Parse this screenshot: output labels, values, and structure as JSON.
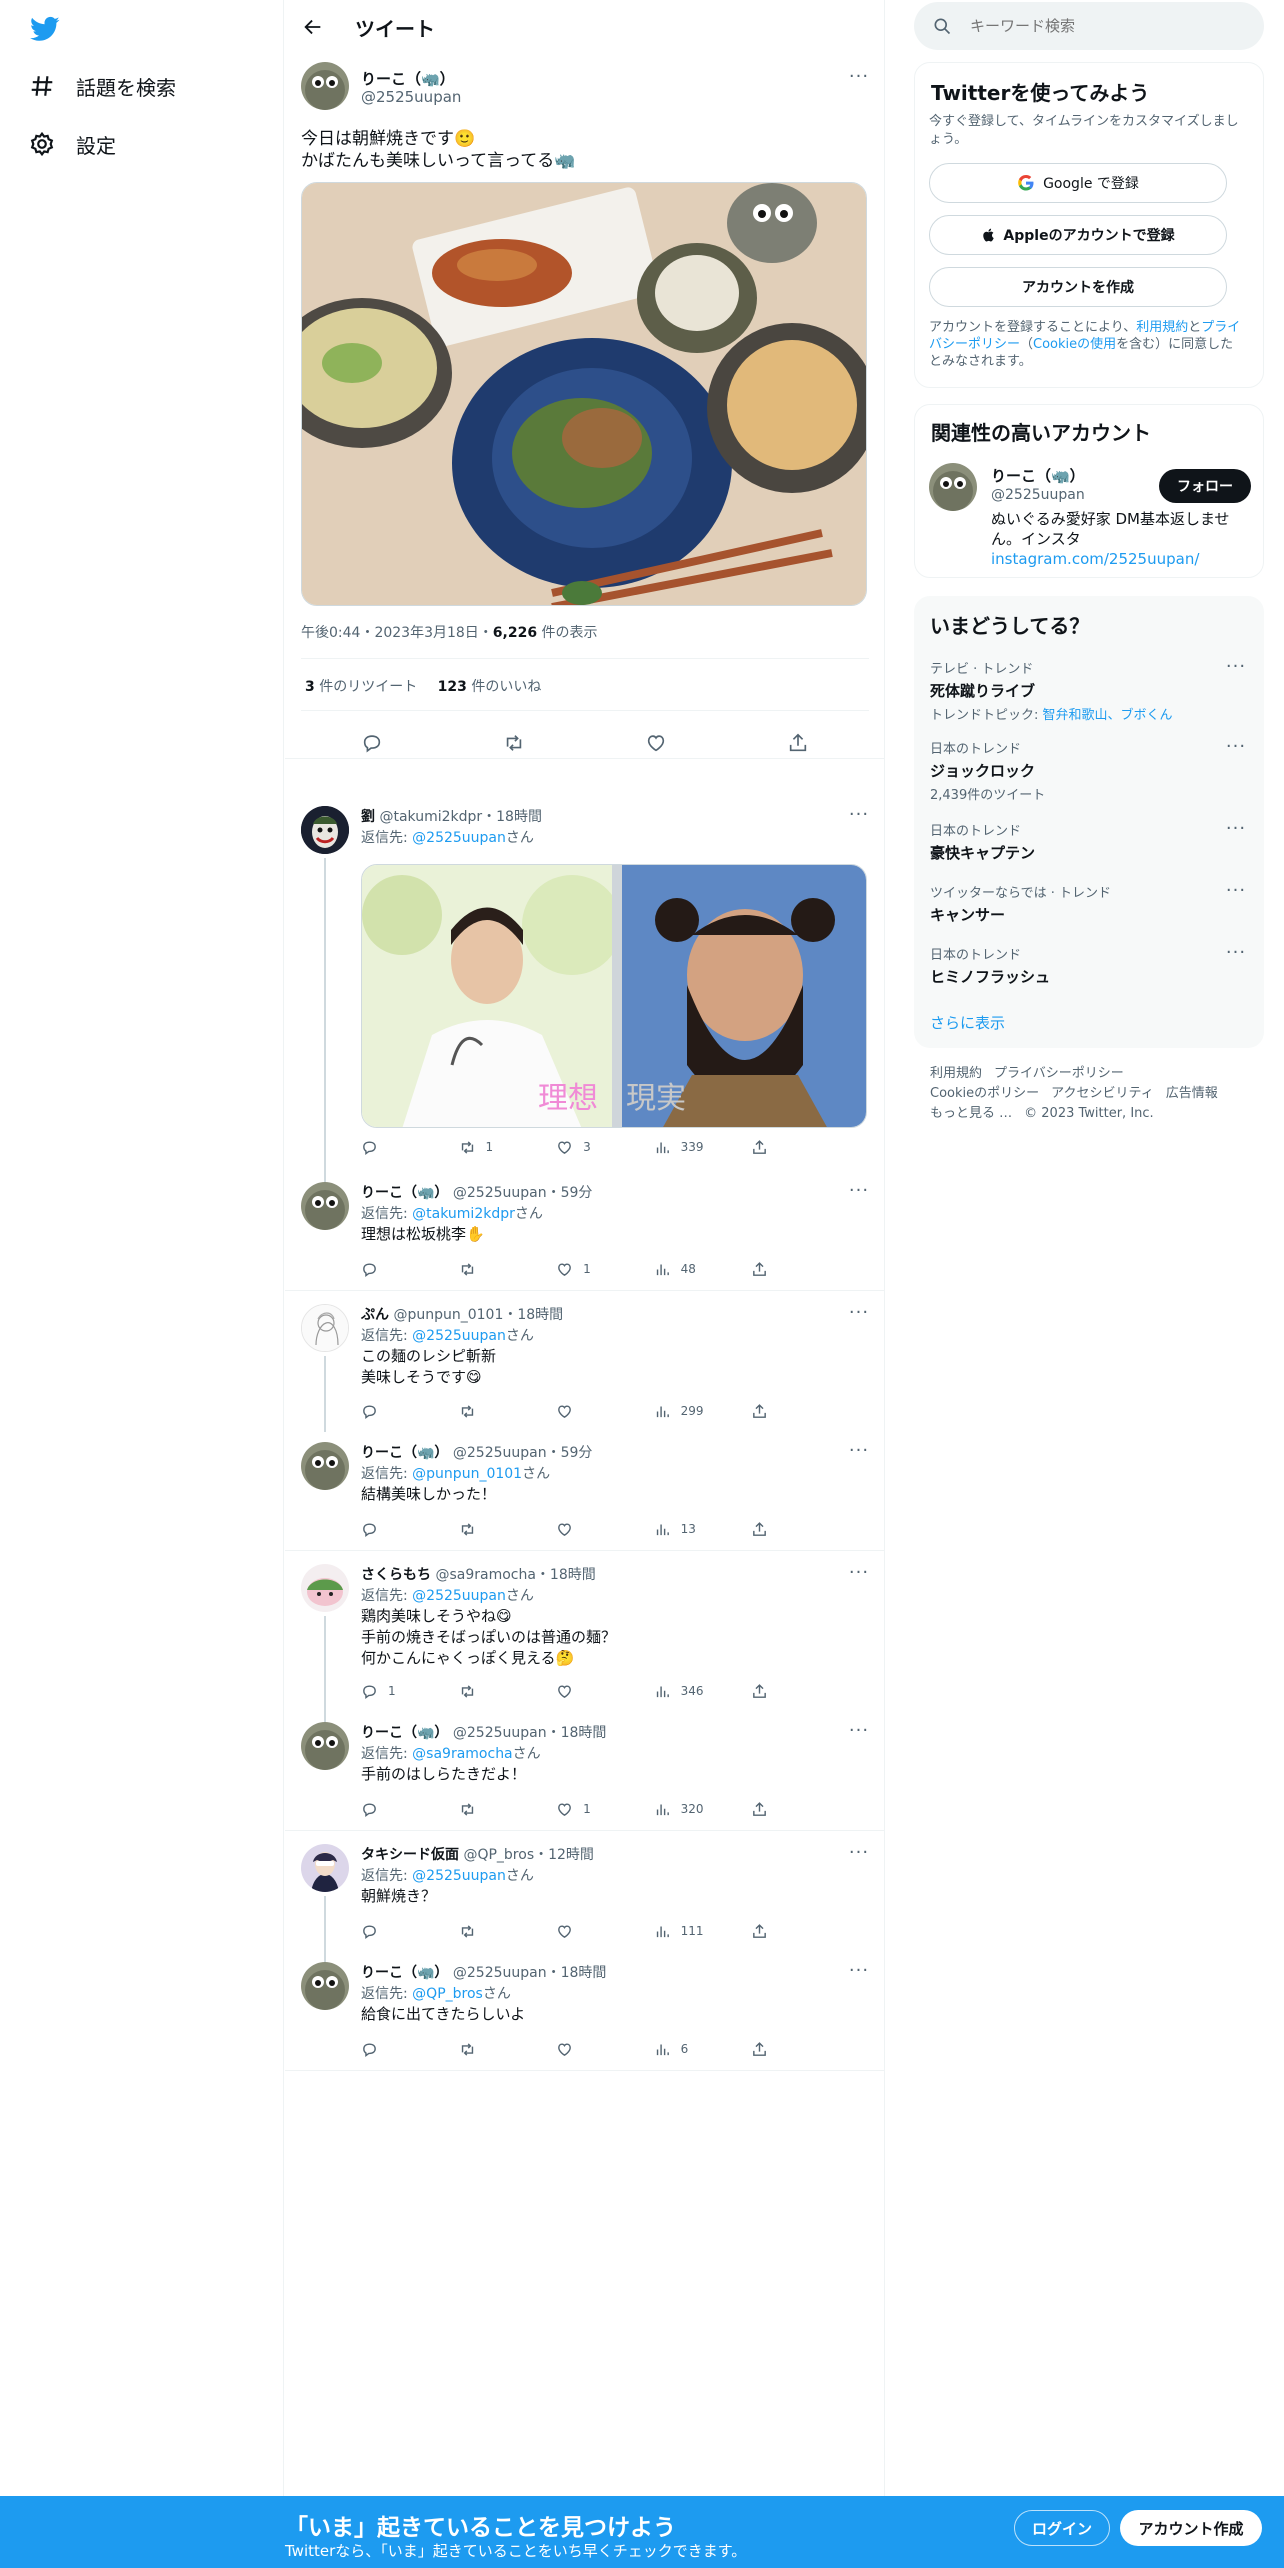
{
  "nav": {
    "explore_label": "話題を検索",
    "settings_label": "設定"
  },
  "header": {
    "title": "ツイート"
  },
  "main_tweet": {
    "name": "りーこ（🦏）",
    "handle": "@2525uupan",
    "text_line1": "今日は朝鮮焼きです🙂",
    "text_line2": "かばたんも美味しいって言ってる🦏",
    "time": "午後0:44・2023年3月18日・",
    "views": "6,226",
    "views_suffix": " 件の表示",
    "retweets": "3",
    "retweets_label": " 件のリツイート",
    "likes": "123",
    "likes_label": " 件のいいね"
  },
  "replies": [
    {
      "name": "劉",
      "meta": " @takumi2kdpr・18時間",
      "to_prefix": "返信先: ",
      "to": "@2525uupan",
      "to_suffix": "さん",
      "text": "",
      "image_caption_left": "理想",
      "image_caption_right": "現実",
      "reply_count": "",
      "retweet_count": "1",
      "like_count": "3",
      "view_count": "339"
    },
    {
      "name": "りーこ（🦏）",
      "meta": " @2525uupan・59分",
      "to_prefix": "返信先: ",
      "to": "@takumi2kdpr",
      "to_suffix": "さん",
      "text": "理想は松坂桃李✋",
      "reply_count": "",
      "retweet_count": "",
      "like_count": "1",
      "view_count": "48"
    },
    {
      "name": "ぷん",
      "meta": " @punpun_0101・18時間",
      "to_prefix": "返信先: ",
      "to": "@2525uupan",
      "to_suffix": "さん",
      "text": "この麺のレシピ斬新",
      "text2": "美味しそうです😋",
      "reply_count": "",
      "retweet_count": "",
      "like_count": "",
      "view_count": "299"
    },
    {
      "name": "りーこ（🦏）",
      "meta": " @2525uupan・59分",
      "to_prefix": "返信先: ",
      "to": "@punpun_0101",
      "to_suffix": "さん",
      "text": "結構美味しかった！",
      "reply_count": "",
      "retweet_count": "",
      "like_count": "",
      "view_count": "13"
    },
    {
      "name": "さくらもち",
      "meta": " @sa9ramocha・18時間",
      "to_prefix": "返信先: ",
      "to": "@2525uupan",
      "to_suffix": "さん",
      "text": "鶏肉美味しそうやね😋",
      "text2": "手前の焼きそばっぽいのは普通の麺？",
      "text3": "何かこんにゃくっぽく見える🤔",
      "reply_count": "1",
      "retweet_count": "",
      "like_count": "",
      "view_count": "346"
    },
    {
      "name": "りーこ（🦏）",
      "meta": " @2525uupan・18時間",
      "to_prefix": "返信先: ",
      "to": "@sa9ramocha",
      "to_suffix": "さん",
      "text": "手前のはしらたきだよ！",
      "reply_count": "",
      "retweet_count": "",
      "like_count": "1",
      "view_count": "320"
    },
    {
      "name": "タキシード仮面",
      "meta": " @QP_bros・12時間",
      "to_prefix": "返信先: ",
      "to": "@2525uupan",
      "to_suffix": "さん",
      "text": "朝鮮焼き？",
      "reply_count": "",
      "retweet_count": "",
      "like_count": "",
      "view_count": "111"
    },
    {
      "name": "りーこ（🦏）",
      "meta": " @2525uupan・18時間",
      "to_prefix": "返信先: ",
      "to": "@QP_bros",
      "to_suffix": "さん",
      "text": "給食に出てきたらしいよ",
      "reply_count": "",
      "retweet_count": "",
      "like_count": "",
      "view_count": "6"
    }
  ],
  "search": {
    "placeholder": "キーワード検索"
  },
  "signup_panel": {
    "title": "Twitterを使ってみよう",
    "subtitle": "今すぐ登録して、タイムラインをカスタマイズしましょう。",
    "google_label": "Google で登録",
    "apple_label": "Appleのアカウントで登録",
    "create_label": "アカウントを作成",
    "note_prefix": "アカウントを登録することにより、",
    "terms_link": "利用規約",
    "note_and": "と",
    "privacy_link": "プライバシーポリシー",
    "note_paren_open": "（",
    "cookie_link": "Cookieの使用",
    "note_suffix": "を含む）に同意したとみなされます。"
  },
  "related_panel": {
    "title": "関連性の高いアカウント",
    "name": "りーこ（🦏）",
    "handle": "@2525uupan",
    "follow_label": "フォロー",
    "bio": "ぬいぐるみ愛好家 DM基本返しません。インスタ",
    "bio_link": "instagram.com/2525uupan/"
  },
  "trends_panel": {
    "title": "いまどうしてる？",
    "items": [
      {
        "context": "テレビ · トレンド",
        "name": "死体蹴りライブ",
        "sub_prefix": "トレンドトピック: ",
        "sub_link": "智弁和歌山、ブボくん"
      },
      {
        "context": "日本のトレンド",
        "name": "ジョックロック",
        "sub": "2,439件のツイート"
      },
      {
        "context": "日本のトレンド",
        "name": "豪快キャプテン"
      },
      {
        "context": "ツイッターならでは · トレンド",
        "name": "キャンサー"
      },
      {
        "context": "日本のトレンド",
        "name": "ヒミノフラッシュ"
      }
    ],
    "show_more": "さらに表示"
  },
  "footer": {
    "terms": "利用規約",
    "privacy": "プライバシーポリシー",
    "cookie": "Cookieのポリシー",
    "accessibility": "アクセシビリティ",
    "ads": "広告情報",
    "more": "もっと見る …",
    "copyright": "© 2023 Twitter, Inc."
  },
  "bottom_bar": {
    "title": "「いま」起きていることを見つけよう",
    "subtitle": "Twitterなら、「いま」起きていることをいち早くチェックできます。",
    "login_label": "ログイン",
    "signup_label": "アカウント作成"
  },
  "colors": {
    "accent": "#1d9bf0",
    "text": "#0f1419",
    "muted": "#536471"
  }
}
